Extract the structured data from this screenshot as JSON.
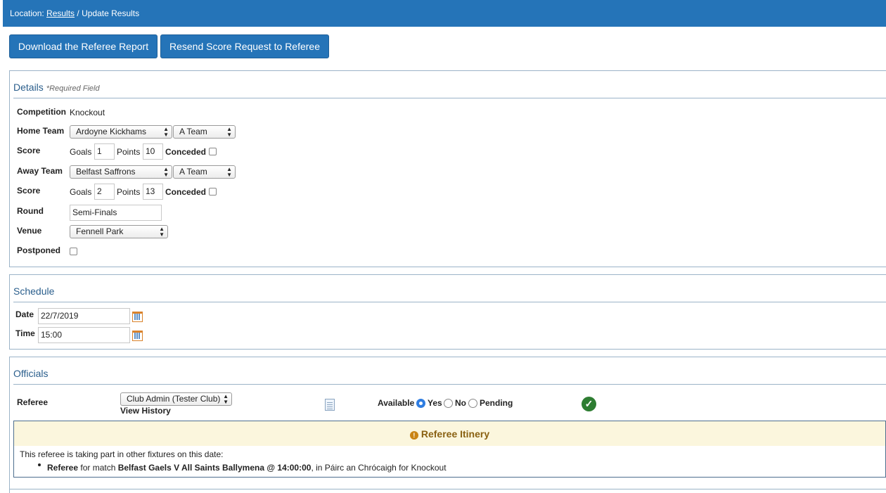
{
  "breadcrumb": {
    "prefix": "Location:",
    "link": "Results",
    "current": "/ Update Results"
  },
  "actions": {
    "download_report": "Download the Referee Report",
    "resend_request": "Resend Score Request to Referee"
  },
  "details": {
    "title": "Details",
    "required_note": "*Required Field",
    "competition_label": "Competition",
    "competition_value": "Knockout",
    "home_team_label": "Home Team",
    "home_club": "Ardoyne Kickhams",
    "home_team": "A Team",
    "home_score": {
      "label": "Score",
      "goals_label": "Goals",
      "goals": "1",
      "points_label": "Points",
      "points": "10",
      "conceded_label": "Conceded"
    },
    "away_team_label": "Away Team",
    "away_club": "Belfast Saffrons",
    "away_team": "A Team",
    "away_score": {
      "label": "Score",
      "goals_label": "Goals",
      "goals": "2",
      "points_label": "Points",
      "points": "13",
      "conceded_label": "Conceded"
    },
    "round_label": "Round",
    "round_value": "Semi-Finals",
    "venue_label": "Venue",
    "venue_value": "Fennell Park",
    "postponed_label": "Postponed"
  },
  "schedule": {
    "title": "Schedule",
    "date_label": "Date",
    "date_value": "22/7/2019",
    "time_label": "Time",
    "time_value": "15:00"
  },
  "officials": {
    "title": "Officials",
    "referee_label": "Referee",
    "referee_value": "Club Admin (Tester Club)",
    "view_history": "View History",
    "available_label": "Available",
    "options": [
      "Yes",
      "No",
      "Pending"
    ],
    "selected": "Yes"
  },
  "itinerary": {
    "title": "Referee Itinery",
    "intro": "This referee is taking part in other fixtures on this date:",
    "item": {
      "role": "Referee",
      "for_match": " for match ",
      "match": "Belfast Gaels V All Saints Ballymena @ 14:00:00",
      "rest": ", in Páirc an Chrócaigh for Knockout"
    }
  },
  "colors": {
    "header_bg": "#2574b8",
    "button_bg": "#2574b8",
    "section_title": "#2a5e8c",
    "itinerary_bg": "#fbf6dd",
    "itinerary_title": "#8a6112",
    "available_ok": "#2e7d32"
  },
  "icons": {
    "calendar": "calendar-icon",
    "report": "document-icon",
    "ok": "check-circle-icon",
    "warning": "warning-icon"
  }
}
